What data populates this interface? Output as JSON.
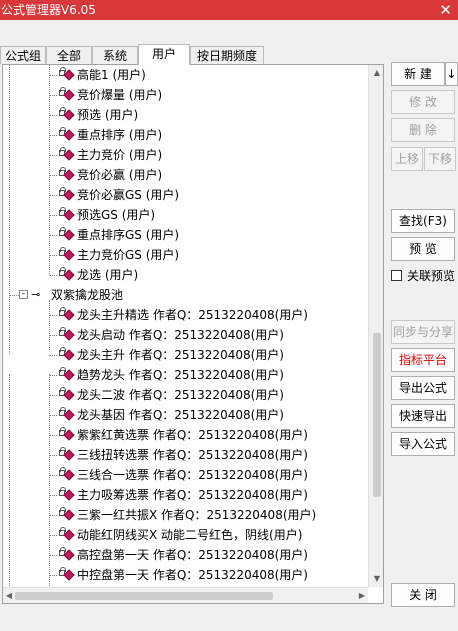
{
  "window": {
    "title": "公式管理器V6.05",
    "close_glyph": "✕"
  },
  "tabs": [
    "公式组",
    "全部",
    "系统",
    "用户",
    "按日期频度"
  ],
  "active_tab": 3,
  "tree": {
    "group1_items": [
      "高能1  (用户)",
      "竞价爆量  (用户)",
      "预选  (用户)",
      "重点排序  (用户)",
      "主力竞价  (用户)",
      "竞价必赢  (用户)",
      "竞价必赢GS  (用户)",
      "预选GS  (用户)",
      "重点排序GS  (用户)",
      "主力竞价GS  (用户)",
      "龙选  (用户)"
    ],
    "group2_name": "双紫擒龙股池",
    "group2_expander": "-",
    "group2_items": [
      "龙头主升精选   作者Q：2513220408(用户)",
      "龙头启动   作者Q：2513220408(用户)",
      "龙头主升   作者Q：2513220408(用户)",
      "趋势龙头   作者Q：2513220408(用户)",
      "龙头二波   作者Q：2513220408(用户)",
      "龙头基因   作者Q：2513220408(用户)",
      "紫紫红黄选票   作者Q：2513220408(用户)",
      "三线扭转选票   作者Q：2513220408(用户)",
      "三线合一选票   作者Q：2513220408(用户)",
      "主力吸筹选票   作者Q：2513220408(用户)",
      "三紫一红共振X   作者Q：2513220408(用户)",
      "动能红阴线买X   动能二号红色，阴线(用户)",
      "高控盘第一天   作者Q：2513220408(用户)",
      "中控盘第一天   作者Q：2513220408(用户)"
    ]
  },
  "buttons": {
    "new": "新  建",
    "new_arrow": "↓",
    "modify": "修  改",
    "delete": "删  除",
    "move_up": "上移",
    "move_down": "下移",
    "find": "查找(F3)",
    "preview": "预  览",
    "sync_share": "同步与分享",
    "indicator_platform": "指标平台",
    "export_formula": "导出公式",
    "quick_export": "快速导出",
    "import_formula": "导入公式",
    "close": "关  闭"
  },
  "checkbox": {
    "label": "关联预览",
    "checked": false
  },
  "colors": {
    "titlebar": "#d9383a",
    "icon_diamond": "#c2185b",
    "red_text": "#e00000"
  }
}
